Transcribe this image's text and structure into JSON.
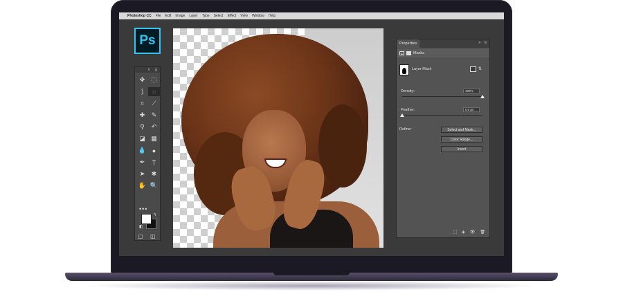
{
  "menubar": {
    "apple": "",
    "items": [
      "Photoshop CC",
      "File",
      "Edit",
      "Image",
      "Layer",
      "Type",
      "Select",
      "Effect",
      "View",
      "Window",
      "Help"
    ]
  },
  "logo": {
    "text": "Ps"
  },
  "toolbar": {
    "head_collapse": "«",
    "head_close": "✕",
    "tools": [
      {
        "name": "move-tool",
        "glyph": "✥"
      },
      {
        "name": "marquee-tool",
        "glyph": "⬚"
      },
      {
        "name": "lasso-tool",
        "glyph": "⟆"
      },
      {
        "name": "quick-selection-tool",
        "glyph": "◌",
        "selected": true
      },
      {
        "name": "crop-tool",
        "glyph": "⌗"
      },
      {
        "name": "eyedropper-tool",
        "glyph": "⟋"
      },
      {
        "name": "healing-brush-tool",
        "glyph": "✚"
      },
      {
        "name": "brush-tool",
        "glyph": "✎"
      },
      {
        "name": "clone-stamp-tool",
        "glyph": "⚲"
      },
      {
        "name": "history-brush-tool",
        "glyph": "↶"
      },
      {
        "name": "eraser-tool",
        "glyph": "◪"
      },
      {
        "name": "gradient-tool",
        "glyph": "▦"
      },
      {
        "name": "blur-tool",
        "glyph": "💧"
      },
      {
        "name": "dodge-tool",
        "glyph": "●"
      },
      {
        "name": "pen-tool",
        "glyph": "✒"
      },
      {
        "name": "type-tool",
        "glyph": "T"
      },
      {
        "name": "path-selection-tool",
        "glyph": "➤"
      },
      {
        "name": "shape-tool",
        "glyph": "✱"
      },
      {
        "name": "hand-tool",
        "glyph": "✋"
      },
      {
        "name": "zoom-tool",
        "glyph": "🔍"
      }
    ],
    "more": "•••",
    "swap": "↰",
    "reset": "◧",
    "quick_mask": "▢",
    "screen_mode": "◫"
  },
  "properties": {
    "tab_label": "Properties",
    "collapse": "»",
    "menu": "≡",
    "masks_label": "Masks",
    "layer_mask_label": "Layer Mask",
    "density_label": "Density:",
    "density_value": "100%",
    "density_level": 1.0,
    "feather_label": "Feather:",
    "feather_value": "0.0 px",
    "feather_level": 0.0,
    "refine_label": "Refine:",
    "buttons": {
      "select_and_mask": "Select and Mask...",
      "color_range": "Color Range...",
      "invert": "Invert"
    },
    "footer_icons": [
      "selection-icon",
      "apply-mask-icon",
      "visibility-icon",
      "trash-icon"
    ],
    "footer_glyphs": [
      "⬚",
      "◈",
      "👁",
      "🗑"
    ]
  }
}
